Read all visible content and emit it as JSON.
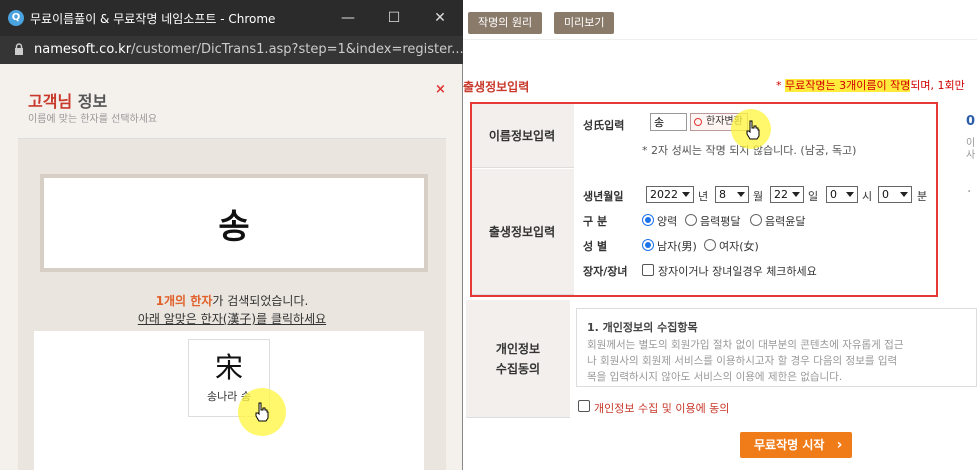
{
  "bg": {
    "tabs": [
      "작명의 원리",
      "미리보기"
    ],
    "section_title": "출생정보입력",
    "notice_prefix": "* ",
    "notice_highlight": "무료작명는 3개이름이 작명",
    "notice_rest": "되며, 1회만",
    "rows": {
      "name_head": "이름정보입력",
      "birth_head": "출생정보입력",
      "privacy_head_1": "개인정보",
      "privacy_head_2": "수집동의"
    },
    "name_input": {
      "label": "성氏입력",
      "value": "송",
      "hanja_button": "한자변환",
      "note": "* 2자 성씨는 작명 되지 않습니다. (남궁, 독고)"
    },
    "birth": {
      "date_label": "생년월일",
      "year": "2022",
      "year_unit": "년",
      "month": "8",
      "month_unit": "월",
      "day": "22",
      "day_unit": "일",
      "hour": "0",
      "hour_unit": "시",
      "minute": "0",
      "minute_unit": "분",
      "calendar_label": "구 분",
      "calendar_options": [
        "양력",
        "음력평달",
        "음력윤달"
      ],
      "gender_label": "성 별",
      "gender_options": [
        "남자(男)",
        "여자(女)"
      ],
      "eldest_label": "장자/장녀",
      "eldest_check": "장자이거나 장녀일경우 체크하세요"
    },
    "privacy": {
      "heading": "1. 개인정보의 수집항목",
      "lines": [
        "회원께서는 별도의 회원가입 절차 없이 대부분의 콘텐츠에 자유롭게 접근",
        "나 회원사의 회원제 서비스를 이용하시고자 할 경우 다음의 정보를 입력",
        "목을 입력하시지 않아도 서비스의 이용에 제한은 없습니다."
      ],
      "consent": "개인정보 수집 및 이용에 동의"
    },
    "start_button": "무료작명 시작",
    "start_chevron": "›",
    "side_text": [
      "0",
      "이",
      "사",
      "·"
    ]
  },
  "popup": {
    "window_title": "무료이름풀이 & 무료작명 네임소프트 - Chrome",
    "favicon_letter": "Q",
    "url_domain": "namesoft.co.kr",
    "url_path": "/customer/DicTrans1.asp?step=1&index=register...",
    "heading_accent": "고객님",
    "heading_rest": " 정보",
    "subheading": "이름에 맞는 한자를 선택하세요",
    "close": "×",
    "name_display": "송",
    "found_count": "1개의 한자",
    "found_rest": "가 검색되었습니다.",
    "click_hint": "아래 알맞은 한자(漢子)를 클릭하세요",
    "hanja": {
      "char": "宋",
      "meaning": "송나라 송"
    },
    "win_buttons": [
      "—",
      "☐",
      "✕"
    ]
  }
}
